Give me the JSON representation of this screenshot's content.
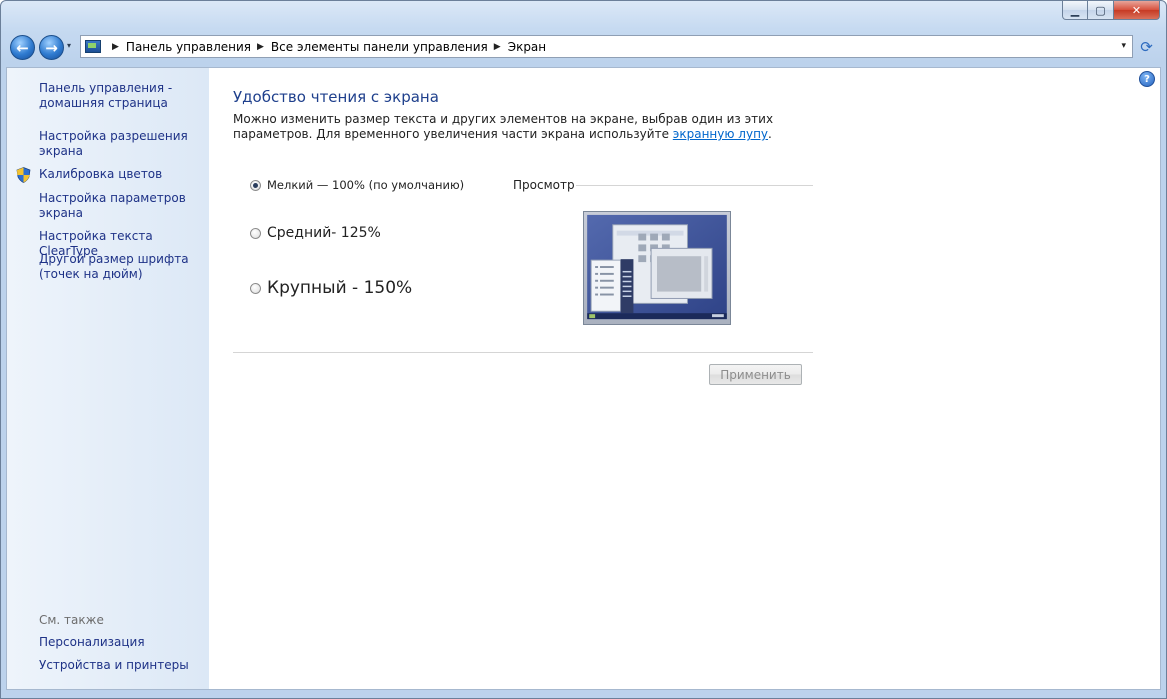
{
  "window": {
    "caption": {
      "minimize": "▁",
      "maximize": "▢",
      "close": "✕"
    }
  },
  "nav": {
    "back_glyph": "←",
    "forward_glyph": "→",
    "dropdown_glyph": "▾",
    "refresh_glyph": "⟳"
  },
  "address": {
    "crumbs": [
      "Панель управления",
      "Все элементы панели управления",
      "Экран"
    ],
    "separator": "▶",
    "dropdown_glyph": "▾"
  },
  "sidebar": {
    "home_link": "Панель управления -\nдомашняя страница",
    "links": [
      "Настройка разрешения\nэкрана",
      "Калибровка цветов",
      "Настройка параметров\nэкрана",
      "Настройка текста ClearType",
      "Другой размер шрифта\n(точек на дюйм)"
    ],
    "see_also_title": "См. также",
    "see_also_links": [
      "Персонализация",
      "Устройства и принтеры"
    ]
  },
  "main": {
    "help_glyph": "?",
    "title": "Удобство чтения с экрана",
    "description_prefix": "Можно изменить размер текста и других элементов на экране, выбрав один из этих параметров. Для временного увеличения части экрана используйте ",
    "description_link": "экранную лупу",
    "description_suffix": ".",
    "options": [
      {
        "label": "Мелкий — 100% (по умолчанию)",
        "checked": true
      },
      {
        "label": "Средний- 125%",
        "checked": false
      },
      {
        "label": "Крупный - 150%",
        "checked": false
      }
    ],
    "preview_label": "Просмотр",
    "apply_button": "Применить"
  },
  "colors": {
    "link": "#1e3287",
    "title": "#1e3f8c",
    "sidebar_bg": "#dce8f6",
    "preview_bg": "#3a4f94"
  }
}
